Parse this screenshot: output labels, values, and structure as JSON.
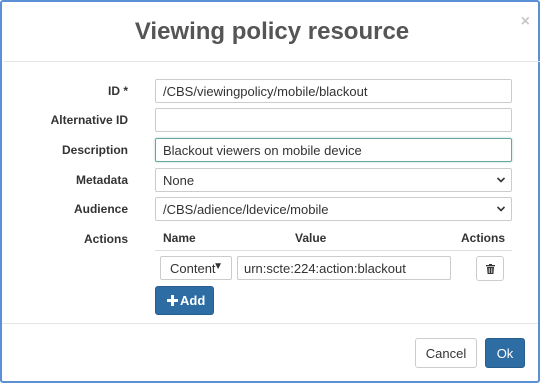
{
  "dialog": {
    "title": "Viewing policy resource",
    "close_glyph": "×",
    "close_icon": "close-icon"
  },
  "form": {
    "id": {
      "label": "ID *",
      "value": "/CBS/viewingpolicy/mobile/blackout"
    },
    "alternative_id": {
      "label": "Alternative ID",
      "value": ""
    },
    "description": {
      "label": "Description",
      "value": "Blackout viewers on mobile device"
    },
    "metadata": {
      "label": "Metadata",
      "selected": "None"
    },
    "audience": {
      "label": "Audience",
      "selected": "/CBS/adience/ldevice/mobile"
    },
    "actions": {
      "label": "Actions",
      "columns": [
        "Name",
        "Value",
        "Actions"
      ],
      "rows": [
        {
          "type": "Content",
          "value": "urn:scte:224:action:blackout",
          "delete_icon": "trash-icon"
        }
      ],
      "add_label": "Add",
      "add_icon": "plus-icon"
    }
  },
  "footer": {
    "cancel_label": "Cancel",
    "ok_label": "Ok"
  },
  "colors": {
    "primary": "#2e6da4",
    "dialog_border": "#5b8fd6",
    "focus_border": "#66a8a1"
  }
}
